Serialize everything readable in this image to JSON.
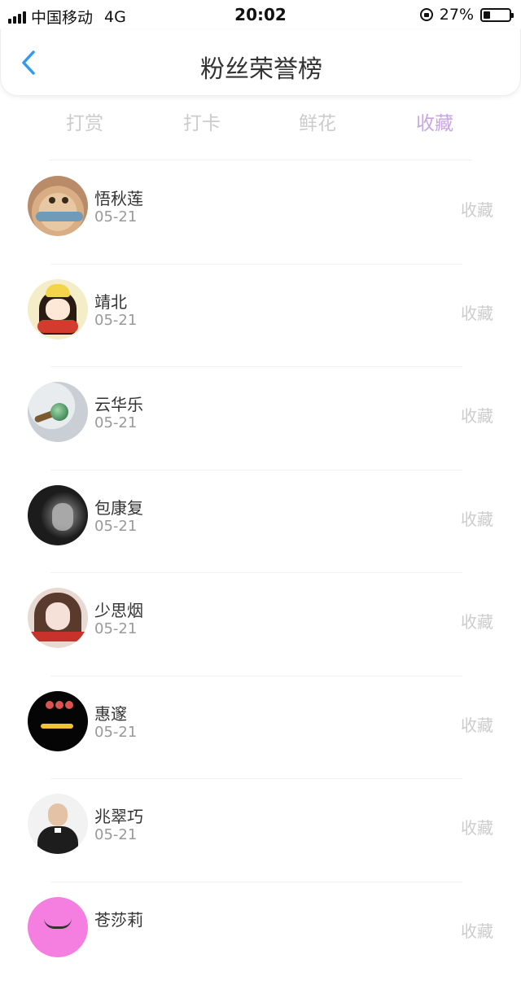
{
  "status_bar": {
    "carrier": "中国移动",
    "network": "4G",
    "time": "20:02",
    "battery": "27%",
    "battery_level": 0.27
  },
  "nav": {
    "title": "粉丝荣誉榜",
    "back_icon": "chevron-left-icon",
    "accent_color": "#2e9bf0"
  },
  "tabs": [
    {
      "label": "打赏",
      "active": false
    },
    {
      "label": "打卡",
      "active": false
    },
    {
      "label": "鲜花",
      "active": false
    },
    {
      "label": "收藏",
      "active": true
    }
  ],
  "colors": {
    "active_tab": "#c8a6e3",
    "inactive_tab": "#cccccc"
  },
  "fans": [
    {
      "name": "悟秋莲",
      "date": "05-21",
      "action": "收藏"
    },
    {
      "name": "靖北",
      "date": "05-21",
      "action": "收藏"
    },
    {
      "name": "云华乐",
      "date": "05-21",
      "action": "收藏"
    },
    {
      "name": "包康复",
      "date": "05-21",
      "action": "收藏"
    },
    {
      "name": "少思烟",
      "date": "05-21",
      "action": "收藏"
    },
    {
      "name": "惠邃",
      "date": "05-21",
      "action": "收藏"
    },
    {
      "name": "兆翠巧",
      "date": "05-21",
      "action": "收藏"
    },
    {
      "name": "苍莎莉",
      "date": "",
      "action": "收藏"
    }
  ]
}
